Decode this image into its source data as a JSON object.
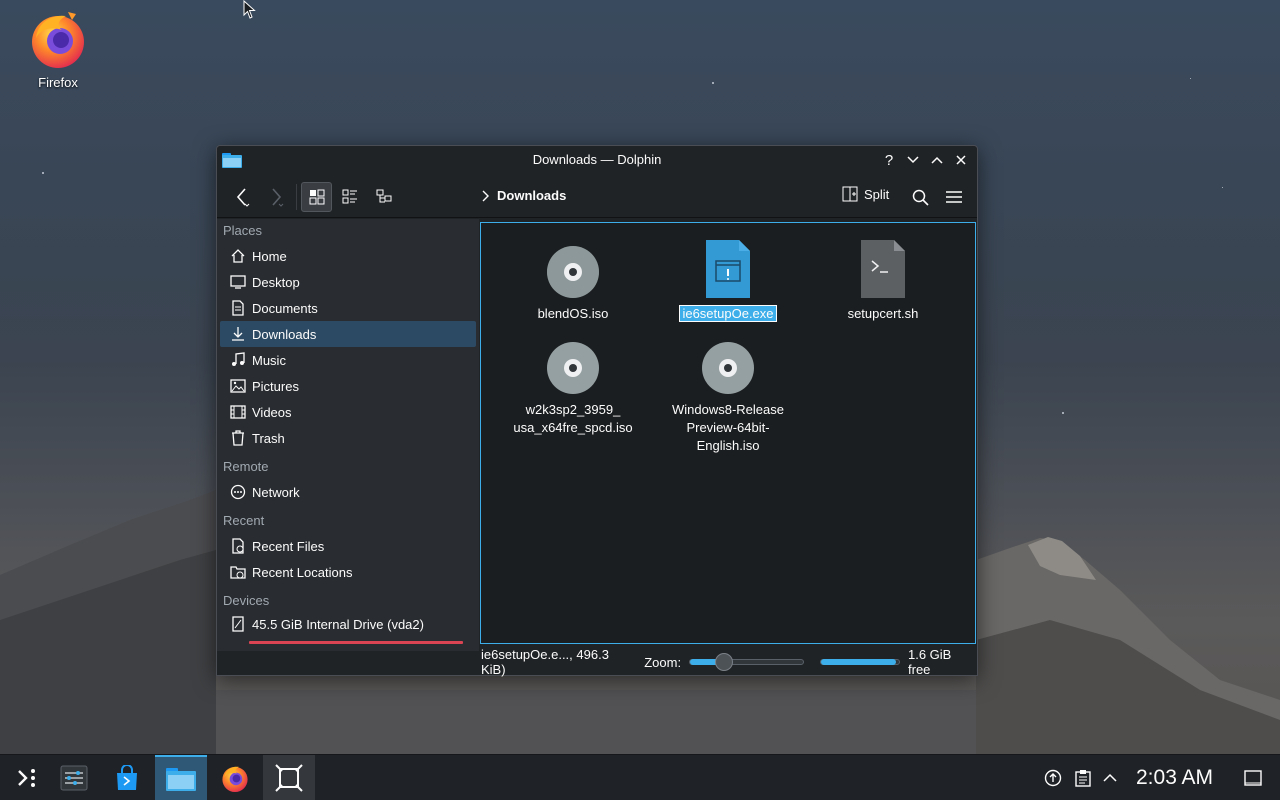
{
  "desktop": {
    "icons": [
      {
        "label": "Firefox",
        "icon": "firefox-icon"
      }
    ]
  },
  "window": {
    "title": "Downloads — Dolphin",
    "controls": [
      "?",
      "minimize",
      "maximize",
      "close"
    ]
  },
  "toolbar": {
    "breadcrumb": "Downloads",
    "split_label": "Split",
    "view_modes": [
      "icons-view",
      "compact-view",
      "details-view"
    ],
    "active_view": "icons-view"
  },
  "sidebar": {
    "sections": {
      "places": "Places",
      "remote": "Remote",
      "recent": "Recent",
      "devices": "Devices"
    },
    "places": [
      {
        "label": "Home",
        "icon": "home-icon"
      },
      {
        "label": "Desktop",
        "icon": "desktop-icon"
      },
      {
        "label": "Documents",
        "icon": "documents-icon"
      },
      {
        "label": "Downloads",
        "icon": "download-icon",
        "selected": true
      },
      {
        "label": "Music",
        "icon": "music-icon"
      },
      {
        "label": "Pictures",
        "icon": "pictures-icon"
      },
      {
        "label": "Videos",
        "icon": "videos-icon"
      },
      {
        "label": "Trash",
        "icon": "trash-icon"
      }
    ],
    "remote": [
      {
        "label": "Network",
        "icon": "network-icon"
      }
    ],
    "recent": [
      {
        "label": "Recent Files",
        "icon": "recent-files-icon"
      },
      {
        "label": "Recent Locations",
        "icon": "recent-locations-icon"
      }
    ],
    "devices": [
      {
        "label": "45.5 GiB Internal Drive (vda2)",
        "icon": "drive-icon",
        "usage": 0.97
      }
    ]
  },
  "files": [
    {
      "name": "blendOS.iso",
      "type": "disc-image"
    },
    {
      "name": "ie6setupOe.exe",
      "type": "executable",
      "selected": true
    },
    {
      "name": "setupcert.sh",
      "type": "shell-script"
    },
    {
      "name_lines": [
        "w2k3sp2_3959_",
        "usa_x64fre_spcd.iso"
      ],
      "type": "disc-image"
    },
    {
      "name_lines": [
        "Windows8-Release",
        "Preview-64bit-",
        "English.iso"
      ],
      "type": "disc-image"
    }
  ],
  "statusbar": {
    "selection_info": "ie6setupOe.e..., 496.3 KiB)",
    "zoom_label": "Zoom:",
    "zoom_level": 0.3,
    "free_label": "1.6 GiB free",
    "free_fraction": 0.96
  },
  "taskbar": {
    "apps": [
      "application-launcher-icon",
      "system-settings-icon",
      "discover-store-icon",
      "dolphin-icon",
      "firefox-icon",
      "screenshot-tool-icon"
    ],
    "active_app": "dolphin-icon",
    "clock": "2:03 AM"
  },
  "colors": {
    "accent": "#3daee9",
    "selection": "#2c4a63",
    "capacity_bar": "#da4453"
  }
}
